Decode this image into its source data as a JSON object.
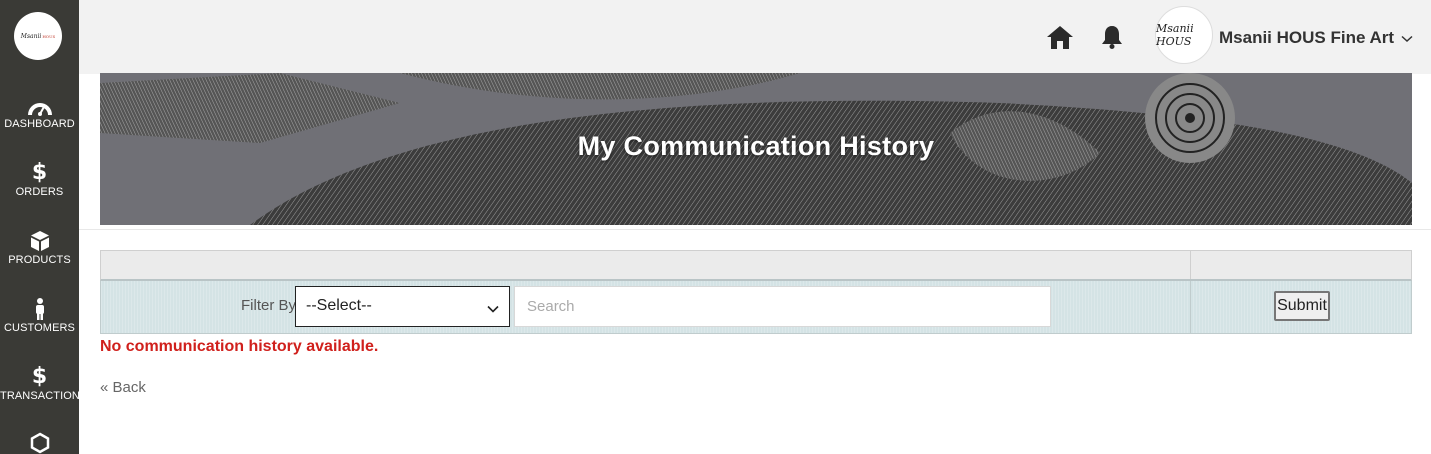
{
  "app": {
    "logo_text": "MsaniiHOUS"
  },
  "sidebar": {
    "items": [
      {
        "label": "DASHBOARD",
        "icon": "dashboard-gauge-icon"
      },
      {
        "label": "ORDERS",
        "icon": "dollar-icon"
      },
      {
        "label": "PRODUCTS",
        "icon": "box-icon"
      },
      {
        "label": "CUSTOMERS",
        "icon": "person-icon"
      },
      {
        "label": "TRANSACTIONS",
        "icon": "dollar-icon"
      },
      {
        "label": "",
        "icon": "hexagon-icon"
      }
    ]
  },
  "header": {
    "user_name": "Msanii HOUS Fine Art",
    "avatar_text": "Msanii HOUS",
    "icons": [
      "home-icon",
      "bell-icon",
      "chevron-down-icon"
    ]
  },
  "banner": {
    "title": "My Communication History"
  },
  "filter": {
    "label": "Filter By",
    "select_value": "--Select--",
    "search_placeholder": "Search",
    "submit_label": "Submit"
  },
  "content": {
    "empty_message": "No communication history available.",
    "back_link": "« Back"
  },
  "colors": {
    "sidebar_bg": "#3a3a36",
    "error_text": "#d0201c",
    "filter_row_bg": "#d4e3e5"
  }
}
